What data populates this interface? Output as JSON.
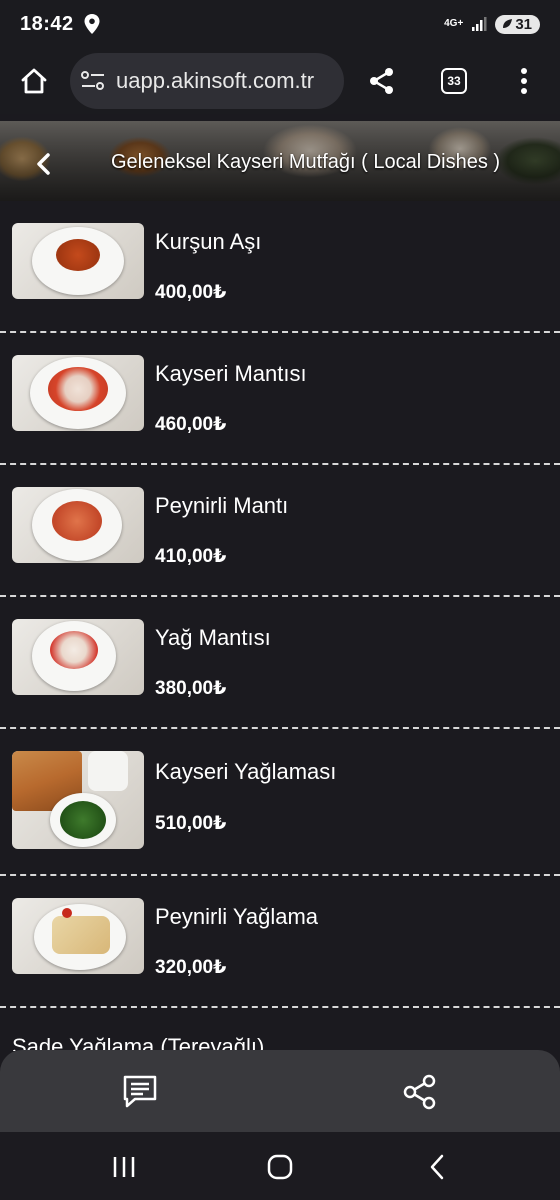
{
  "status_bar": {
    "time": "18:42",
    "network": "4G+",
    "battery": "31",
    "icons": [
      "location-icon",
      "signal-icon",
      "battery-icon"
    ]
  },
  "browser": {
    "url": "uapp.akinsoft.com.tr",
    "tab_count": "33",
    "icons": [
      "home-icon",
      "site-settings-icon",
      "share-icon",
      "tabs-icon",
      "more-icon"
    ]
  },
  "category": {
    "title": "Geleneksel Kayseri Mutfağı ( Local Dishes )"
  },
  "menu": {
    "items": [
      {
        "name": "Kurşun Aşı",
        "price": "400,00₺"
      },
      {
        "name": "Kayseri Mantısı",
        "price": "460,00₺"
      },
      {
        "name": "Peynirli Mantı",
        "price": "410,00₺"
      },
      {
        "name": "Yağ Mantısı",
        "price": "380,00₺"
      },
      {
        "name": "Kayseri Yağlaması",
        "price": "510,00₺"
      },
      {
        "name": "Peynirli Yağlama",
        "price": "320,00₺"
      }
    ],
    "partial_item": "Sade Yağlama (Tereyağlı)"
  },
  "actions": {
    "icons": [
      "chat-icon",
      "share-icon"
    ]
  },
  "system_nav": {
    "icons": [
      "recents-icon",
      "home-circle-icon",
      "back-icon"
    ]
  },
  "colors": {
    "background": "#1b1a1f",
    "action_bar": "#39393d",
    "text": "#ffffff",
    "divider": "#d8d8d8"
  }
}
